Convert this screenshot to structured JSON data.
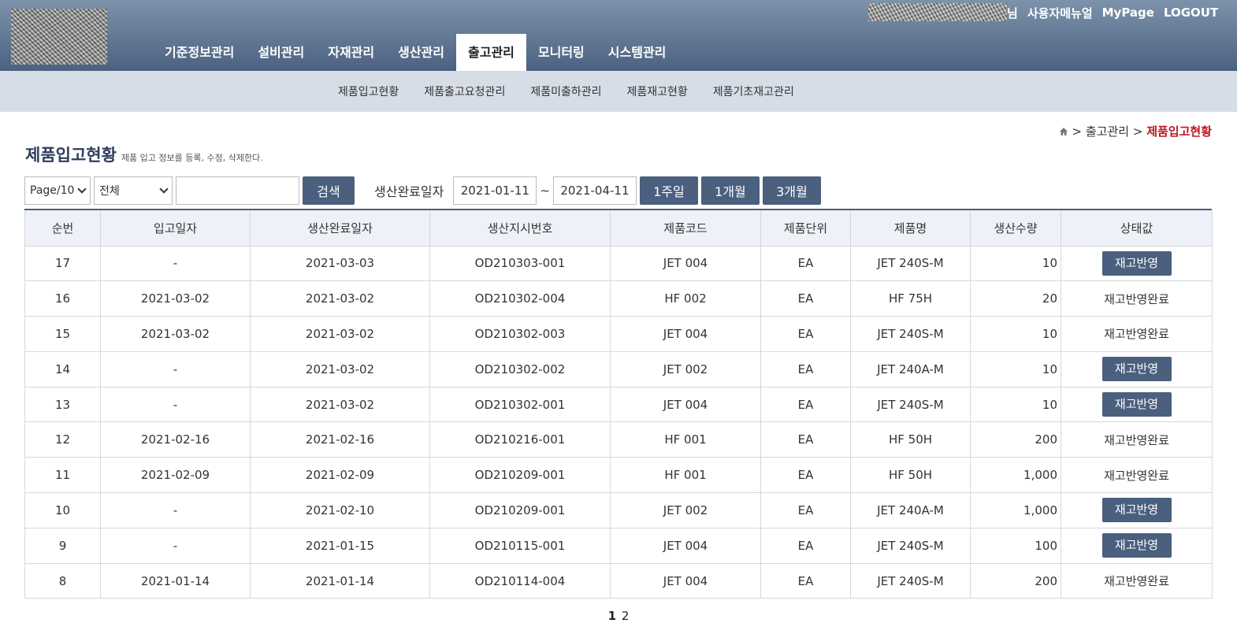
{
  "header": {
    "user_suffix": "님",
    "links": [
      "사용자메뉴얼",
      "MyPage",
      "LOGOUT"
    ]
  },
  "main_nav": [
    "기준정보관리",
    "설비관리",
    "자재관리",
    "생산관리",
    "출고관리",
    "모니터링",
    "시스템관리"
  ],
  "main_nav_active": "출고관리",
  "sub_nav": [
    "제품입고현황",
    "제품출고요청관리",
    "제품미출하관리",
    "제품재고현황",
    "제품기초재고관리"
  ],
  "breadcrumb": {
    "icon": "home-icon",
    "sep": ">",
    "section": "출고관리",
    "current": "제품입고현황"
  },
  "page": {
    "title": "제품입고현황",
    "description": "제품 입고 정보를 등록, 수정, 삭제한다."
  },
  "toolbar": {
    "page_size": "Page/10",
    "filter": "전체",
    "search_value": "",
    "search_label": "검색",
    "date_label": "생산완료일자",
    "date_from": "2021-01-11",
    "tilde": "~",
    "date_to": "2021-04-11",
    "range_buttons": [
      "1주일",
      "1개월",
      "3개월"
    ]
  },
  "table": {
    "columns": [
      "순번",
      "입고일자",
      "생산완료일자",
      "생산지시번호",
      "제품코드",
      "제품단위",
      "제품명",
      "생산수량",
      "상태값"
    ],
    "rows": [
      {
        "no": "17",
        "in_date": "-",
        "done_date": "2021-03-03",
        "order_no": "OD210303-001",
        "code": "JET 004",
        "unit": "EA",
        "name": "JET 240S-M",
        "qty": "10",
        "status": "재고반영",
        "status_is_button": true
      },
      {
        "no": "16",
        "in_date": "2021-03-02",
        "done_date": "2021-03-02",
        "order_no": "OD210302-004",
        "code": "HF 002",
        "unit": "EA",
        "name": "HF 75H",
        "qty": "20",
        "status": "재고반영완료",
        "status_is_button": false
      },
      {
        "no": "15",
        "in_date": "2021-03-02",
        "done_date": "2021-03-02",
        "order_no": "OD210302-003",
        "code": "JET 004",
        "unit": "EA",
        "name": "JET 240S-M",
        "qty": "10",
        "status": "재고반영완료",
        "status_is_button": false
      },
      {
        "no": "14",
        "in_date": "-",
        "done_date": "2021-03-02",
        "order_no": "OD210302-002",
        "code": "JET 002",
        "unit": "EA",
        "name": "JET 240A-M",
        "qty": "10",
        "status": "재고반영",
        "status_is_button": true
      },
      {
        "no": "13",
        "in_date": "-",
        "done_date": "2021-03-02",
        "order_no": "OD210302-001",
        "code": "JET 004",
        "unit": "EA",
        "name": "JET 240S-M",
        "qty": "10",
        "status": "재고반영",
        "status_is_button": true
      },
      {
        "no": "12",
        "in_date": "2021-02-16",
        "done_date": "2021-02-16",
        "order_no": "OD210216-001",
        "code": "HF 001",
        "unit": "EA",
        "name": "HF 50H",
        "qty": "200",
        "status": "재고반영완료",
        "status_is_button": false
      },
      {
        "no": "11",
        "in_date": "2021-02-09",
        "done_date": "2021-02-09",
        "order_no": "OD210209-001",
        "code": "HF 001",
        "unit": "EA",
        "name": "HF 50H",
        "qty": "1,000",
        "status": "재고반영완료",
        "status_is_button": false
      },
      {
        "no": "10",
        "in_date": "-",
        "done_date": "2021-02-10",
        "order_no": "OD210209-001",
        "code": "JET 002",
        "unit": "EA",
        "name": "JET 240A-M",
        "qty": "1,000",
        "status": "재고반영",
        "status_is_button": true
      },
      {
        "no": "9",
        "in_date": "-",
        "done_date": "2021-01-15",
        "order_no": "OD210115-001",
        "code": "JET 004",
        "unit": "EA",
        "name": "JET 240S-M",
        "qty": "100",
        "status": "재고반영",
        "status_is_button": true
      },
      {
        "no": "8",
        "in_date": "2021-01-14",
        "done_date": "2021-01-14",
        "order_no": "OD210114-004",
        "code": "JET 004",
        "unit": "EA",
        "name": "JET 240S-M",
        "qty": "200",
        "status": "재고반영완료",
        "status_is_button": false
      }
    ]
  },
  "pagination": {
    "pages": [
      "1",
      "2"
    ],
    "current": "1"
  },
  "colors": {
    "header_dark": "#4b6180",
    "subnav_bg": "#d7dde7",
    "button": "#4b5f7e",
    "breadcrumb_current": "#c0141e"
  }
}
